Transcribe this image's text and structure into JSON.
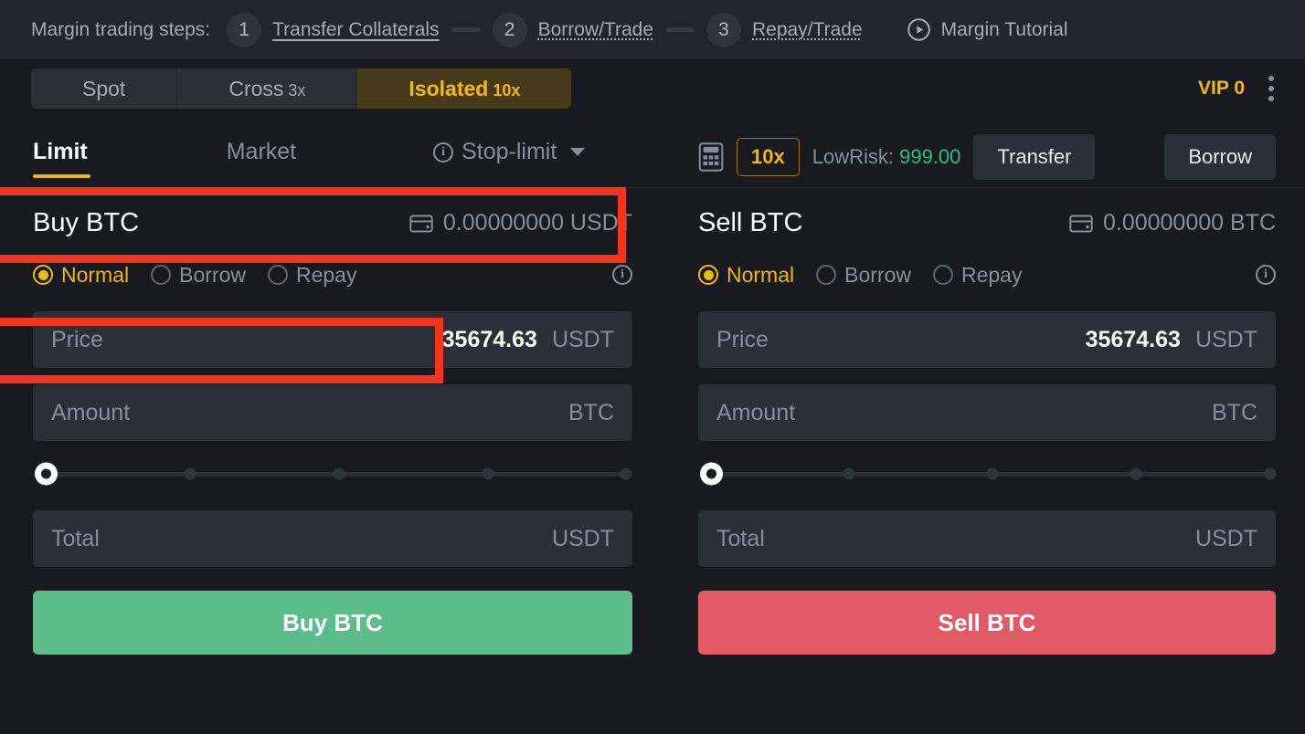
{
  "steps_bar": {
    "label": "Margin trading steps:",
    "steps": [
      {
        "num": "1",
        "text": "Transfer Collaterals",
        "underline": "solid"
      },
      {
        "num": "2",
        "text": "Borrow/Trade",
        "underline": "dotted"
      },
      {
        "num": "3",
        "text": "Repay/Trade",
        "underline": "dotted"
      }
    ],
    "tutorial": {
      "icon": "play-circle-icon",
      "label": "Margin Tutorial"
    }
  },
  "mode_row": {
    "tabs": [
      {
        "label": "Spot",
        "leverage": "",
        "active": false
      },
      {
        "label": "Cross",
        "leverage": "3x",
        "active": false
      },
      {
        "label": "Isolated",
        "leverage": "10x",
        "active": true
      }
    ],
    "vip": "VIP 0",
    "kebab_icon": "more-vertical-icon"
  },
  "order_type_row": {
    "tabs": [
      {
        "label": "Limit",
        "active": true
      },
      {
        "label": "Market",
        "active": false
      },
      {
        "label": "Stop-limit",
        "active": false,
        "has_info": true,
        "has_caret": true
      }
    ],
    "calculator_icon": "calculator-icon",
    "leverage": "10x",
    "risk_label": "LowRisk:",
    "risk_value": "999.00",
    "transfer_button": "Transfer",
    "borrow_button": "Borrow"
  },
  "buy": {
    "title": "Buy BTC",
    "wallet_icon": "wallet-icon",
    "balance": "0.00000000 USDT",
    "modes": [
      {
        "label": "Normal",
        "selected": true
      },
      {
        "label": "Borrow",
        "selected": false
      },
      {
        "label": "Repay",
        "selected": false
      }
    ],
    "info_icon": "info-circle-icon",
    "price": {
      "label": "Price",
      "value": "35674.63",
      "unit": "USDT"
    },
    "amount": {
      "label": "Amount",
      "value": "",
      "unit": "BTC"
    },
    "slider": {
      "value": 0,
      "ticks": [
        0,
        25,
        50,
        75,
        100
      ]
    },
    "total": {
      "label": "Total",
      "value": "",
      "unit": "USDT"
    },
    "submit": "Buy BTC"
  },
  "sell": {
    "title": "Sell BTC",
    "wallet_icon": "wallet-icon",
    "balance": "0.00000000 BTC",
    "modes": [
      {
        "label": "Normal",
        "selected": true
      },
      {
        "label": "Borrow",
        "selected": false
      },
      {
        "label": "Repay",
        "selected": false
      }
    ],
    "info_icon": "info-circle-icon",
    "price": {
      "label": "Price",
      "value": "35674.63",
      "unit": "USDT"
    },
    "amount": {
      "label": "Amount",
      "value": "",
      "unit": "BTC"
    },
    "slider": {
      "value": 0,
      "ticks": [
        0,
        25,
        50,
        75,
        100
      ]
    },
    "total": {
      "label": "Total",
      "value": "",
      "unit": "USDT"
    },
    "submit": "Sell BTC"
  },
  "colors": {
    "accent_yellow": "#f0b90b",
    "buy_green": "#5cbd8a",
    "sell_red": "#e15b66",
    "risk_green": "#2ebd85",
    "annotation_red": "#f5341f",
    "background": "#181a20",
    "panel": "#2b2f38"
  }
}
